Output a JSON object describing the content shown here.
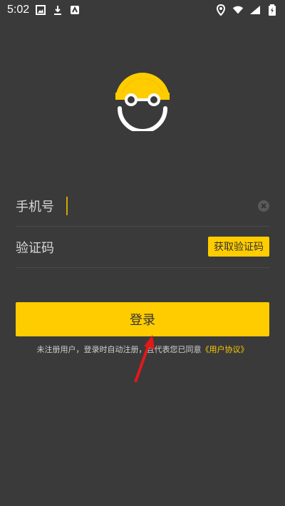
{
  "status_bar": {
    "time": "5:02",
    "left_icons": [
      "image-icon",
      "download-icon",
      "app-icon"
    ],
    "right_icons": [
      "location-icon",
      "wifi-icon",
      "signal-icon",
      "battery-icon"
    ]
  },
  "login": {
    "phone_label": "手机号",
    "phone_value": "",
    "code_label": "验证码",
    "code_value": "",
    "get_code_label": "获取验证码",
    "login_label": "登录",
    "agreement_text": "未注册用户，登录时自动注册，且代表您已同意",
    "agreement_link": "《用户协议》"
  },
  "colors": {
    "background": "#3a3a3a",
    "accent": "#ffcc00"
  }
}
